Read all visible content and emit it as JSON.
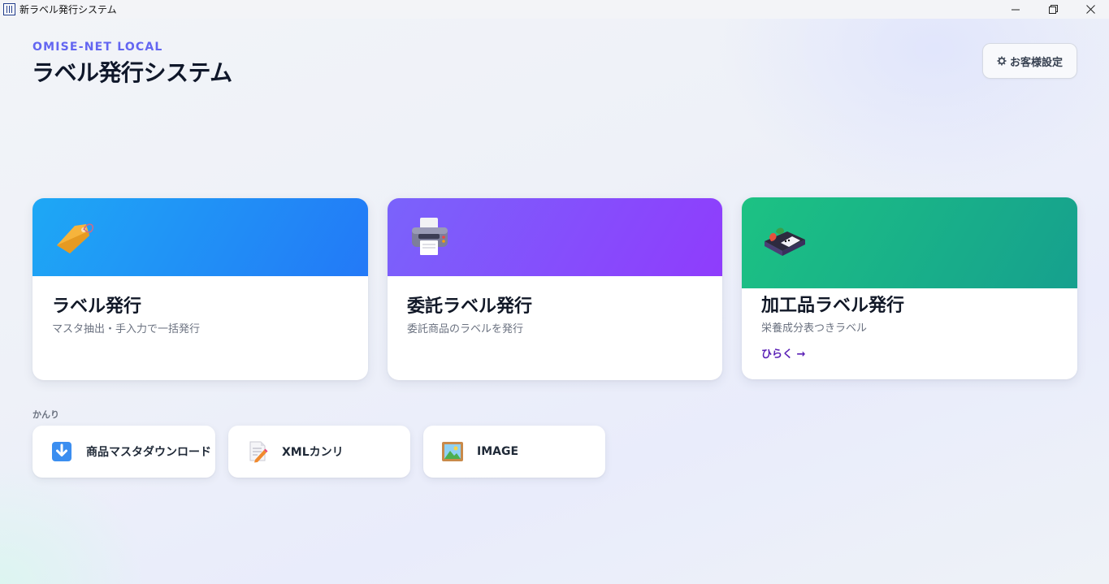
{
  "window": {
    "title": "新ラベル発行システム",
    "controls": [
      "minimize-icon",
      "restore-icon",
      "close-icon"
    ]
  },
  "header": {
    "brand": "OMISE-NET LOCAL",
    "title": "ラベル発行システム",
    "settings_icon": "gear-icon",
    "settings_label": "お客様設定"
  },
  "cards": [
    {
      "icon": "price-tag-icon",
      "title": "ラベル発行",
      "description": "マスタ抽出・手入力で一括発行",
      "header_color": "#2379f7"
    },
    {
      "icon": "printer-icon",
      "title": "委託ラベル発行",
      "description": "委託商品のラベルを発行",
      "header_color": "#8f3cfc"
    },
    {
      "icon": "bento-box-icon",
      "title": "加工品ラベル発行",
      "description": "栄養成分表つきラベル",
      "link": "ひらく →",
      "header_color": "#16a08e"
    }
  ],
  "tools_section": {
    "label": "かんり",
    "items": [
      {
        "icon": "download-arrow-icon",
        "label": "商品マスタダウンロード"
      },
      {
        "icon": "memo-pencil-icon",
        "label": "XMLカンリ"
      },
      {
        "icon": "framed-picture-icon",
        "label": "IMAGE"
      }
    ]
  },
  "colors": {
    "accent": "#6366f1",
    "blue": "#2379f7",
    "purple": "#8f3cfc",
    "green": "#16a08e",
    "link": "#5b21b6"
  }
}
